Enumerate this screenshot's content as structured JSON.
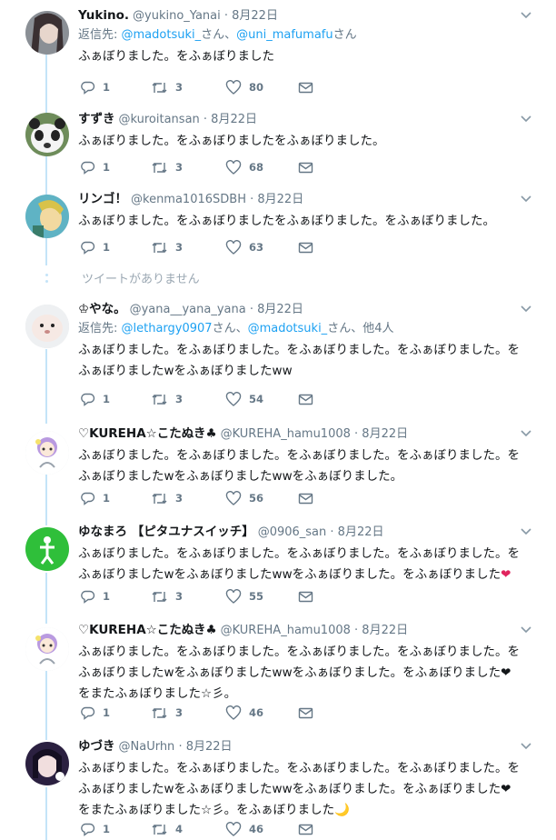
{
  "missing_tweet_text": "ツイートがありません",
  "tweets": [
    {
      "name": "Yukino.",
      "handle": "@yukino_Yanai",
      "time": "· 8月22日",
      "reply_prefix": "返信先: ",
      "reply_link1": "@madotsuki_",
      "reply_mid": "さん、",
      "reply_link2": "@uni_mafumafu",
      "reply_suffix": "さん",
      "text_lines": [
        "ふぁぼりました。をふぁぼりました"
      ],
      "replies": "1",
      "retweets": "3",
      "likes": "80"
    },
    {
      "name": "すずき",
      "handle": "@kuroitansan",
      "time": "· 8月22日",
      "text_lines": [
        "ふぁぼりました。をふぁぼりましたをふぁぼりました。"
      ],
      "replies": "1",
      "retweets": "3",
      "likes": "68"
    },
    {
      "name": "リンゴ！",
      "handle": "@kenma1016SDBH",
      "time": "· 8月22日",
      "text_lines": [
        "ふぁぼりました。をふぁぼりましたをふぁぼりました。をふぁぼりました。"
      ],
      "replies": "1",
      "retweets": "3",
      "likes": "63"
    },
    {
      "name": "♔やな。",
      "handle": "@yana__yana_yana",
      "time": "· 8月22日",
      "reply_prefix": "返信先: ",
      "reply_link1": "@lethargy0907",
      "reply_mid": "さん、",
      "reply_link2": "@madotsuki_",
      "reply_suffix": "さん、他4人",
      "text_lines": [
        "ふぁぼりました。をふぁぼりました。をふぁぼりました。をふぁぼりました。を",
        "ふぁぼりましたwをふぁぼりましたww"
      ],
      "replies": "1",
      "retweets": "3",
      "likes": "54"
    },
    {
      "name": "♡KUREHA☆こたぬき♣",
      "handle": "@KUREHA_hamu1008",
      "time": "· 8月22日",
      "text_lines": [
        "ふぁぼりました。をふぁぼりました。をふぁぼりました。をふぁぼりました。を",
        "ふぁぼりましたwをふぁぼりましたwwをふぁぼりました。"
      ],
      "replies": "1",
      "retweets": "3",
      "likes": "56"
    },
    {
      "name": "ゆなまろ 【ピタユナスイッチ】",
      "handle": "@0906_san",
      "time": "· 8月22日",
      "text_lines": [
        "ふぁぼりました。をふぁぼりました。をふぁぼりました。をふぁぼりました。を",
        "ふぁぼりましたwをふぁぼりましたwwをふぁぼりました。をふぁぼりました"
      ],
      "text_end_emoji": "❤",
      "replies": "1",
      "retweets": "3",
      "likes": "55"
    },
    {
      "name": "♡KUREHA☆こたぬき♣",
      "handle": "@KUREHA_hamu1008",
      "time": "· 8月22日",
      "text_lines": [
        "ふぁぼりました。をふぁぼりました。をふぁぼりました。をふぁぼりました。を",
        "ふぁぼりましたwをふぁぼりましたwwをふぁぼりました。をふぁぼりました❤",
        "をまたふぁぼりました☆彡。"
      ],
      "replies": "1",
      "retweets": "3",
      "likes": "46"
    },
    {
      "name": "ゆづき",
      "handle": "@NaUrhn",
      "time": "· 8月22日",
      "text_lines": [
        "ふぁぼりました。をふぁぼりました。をふぁぼりました。をふぁぼりました。を",
        "ふぁぼりましたwをふぁぼりましたwwをふぁぼりました。をふぁぼりました❤",
        "をまたふぁぼりました☆彡。をふぁぼりました"
      ],
      "text_end_emoji": "🌙",
      "replies": "1",
      "retweets": "4",
      "likes": "46"
    }
  ],
  "colors": {
    "link": "#1da1f2",
    "heart": "#e0245e",
    "thread": "#c4e4f8",
    "muted": "#657786"
  }
}
